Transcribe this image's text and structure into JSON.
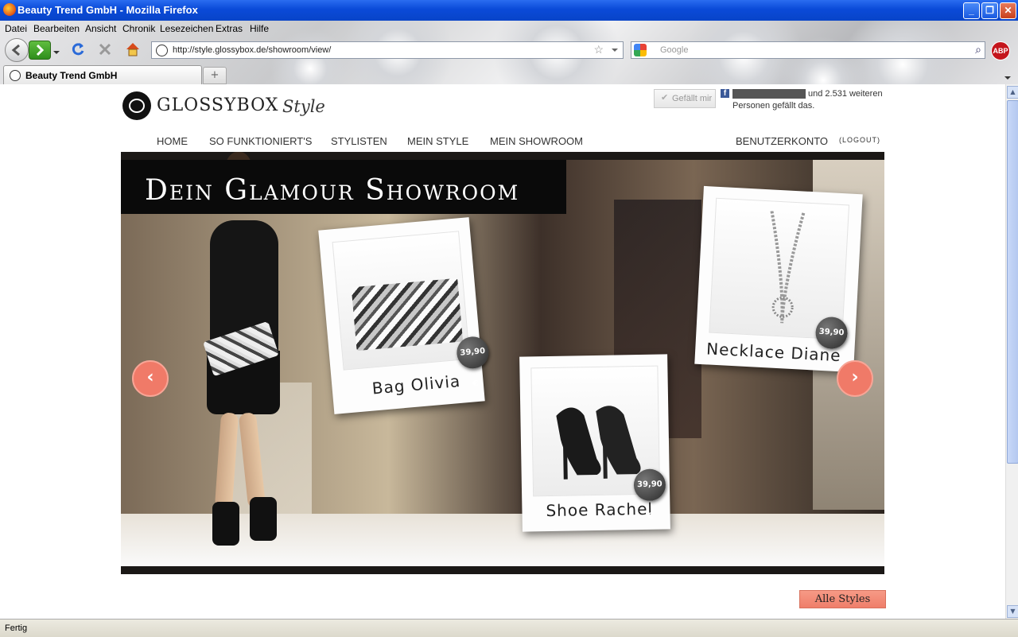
{
  "window": {
    "title": "Beauty Trend GmbH - Mozilla Firefox",
    "controls": {
      "minimize": "_",
      "maximize": "❐",
      "close": "✕"
    }
  },
  "menu": [
    "Datei",
    "Bearbeiten",
    "Ansicht",
    "Chronik",
    "Lesezeichen",
    "Extras",
    "Hilfe"
  ],
  "toolbar": {
    "url": "http://style.glossybox.de/showroom/view/",
    "search_placeholder": "Google",
    "abp_label": "ABP"
  },
  "tabs": [
    {
      "label": "Beauty Trend GmbH"
    }
  ],
  "new_tab_label": "+",
  "site": {
    "logo_text": "GLOSSYBOX",
    "logo_sub": "Style",
    "facebook": {
      "like_label": "Gefällt mir",
      "icon_label": "f",
      "count_text": "und 2.531 weiteren",
      "suffix_text": "Personen gefällt das."
    },
    "nav": [
      "HOME",
      "SO FUNKTIONIERT'S",
      "STYLISTEN",
      "MEIN STYLE",
      "MEIN SHOWROOM"
    ],
    "account": "BENUTZERKONTO",
    "logout": "(LOGOUT)",
    "banner": {
      "headline": "Dein Glamour Showroom",
      "products": [
        {
          "name": "Bag Olivia",
          "price": "39,90 €"
        },
        {
          "name": "Shoe Rachel",
          "price": "39,90 €"
        },
        {
          "name": "Necklace Diane",
          "price": "39,90 €"
        }
      ],
      "prev": "‹",
      "next": "›"
    },
    "all_styles": "Alle Styles"
  },
  "status": "Fertig",
  "colors": {
    "accent": "#f07a68",
    "titlebar": "#0a4ad8",
    "fb": "#3b5998"
  }
}
